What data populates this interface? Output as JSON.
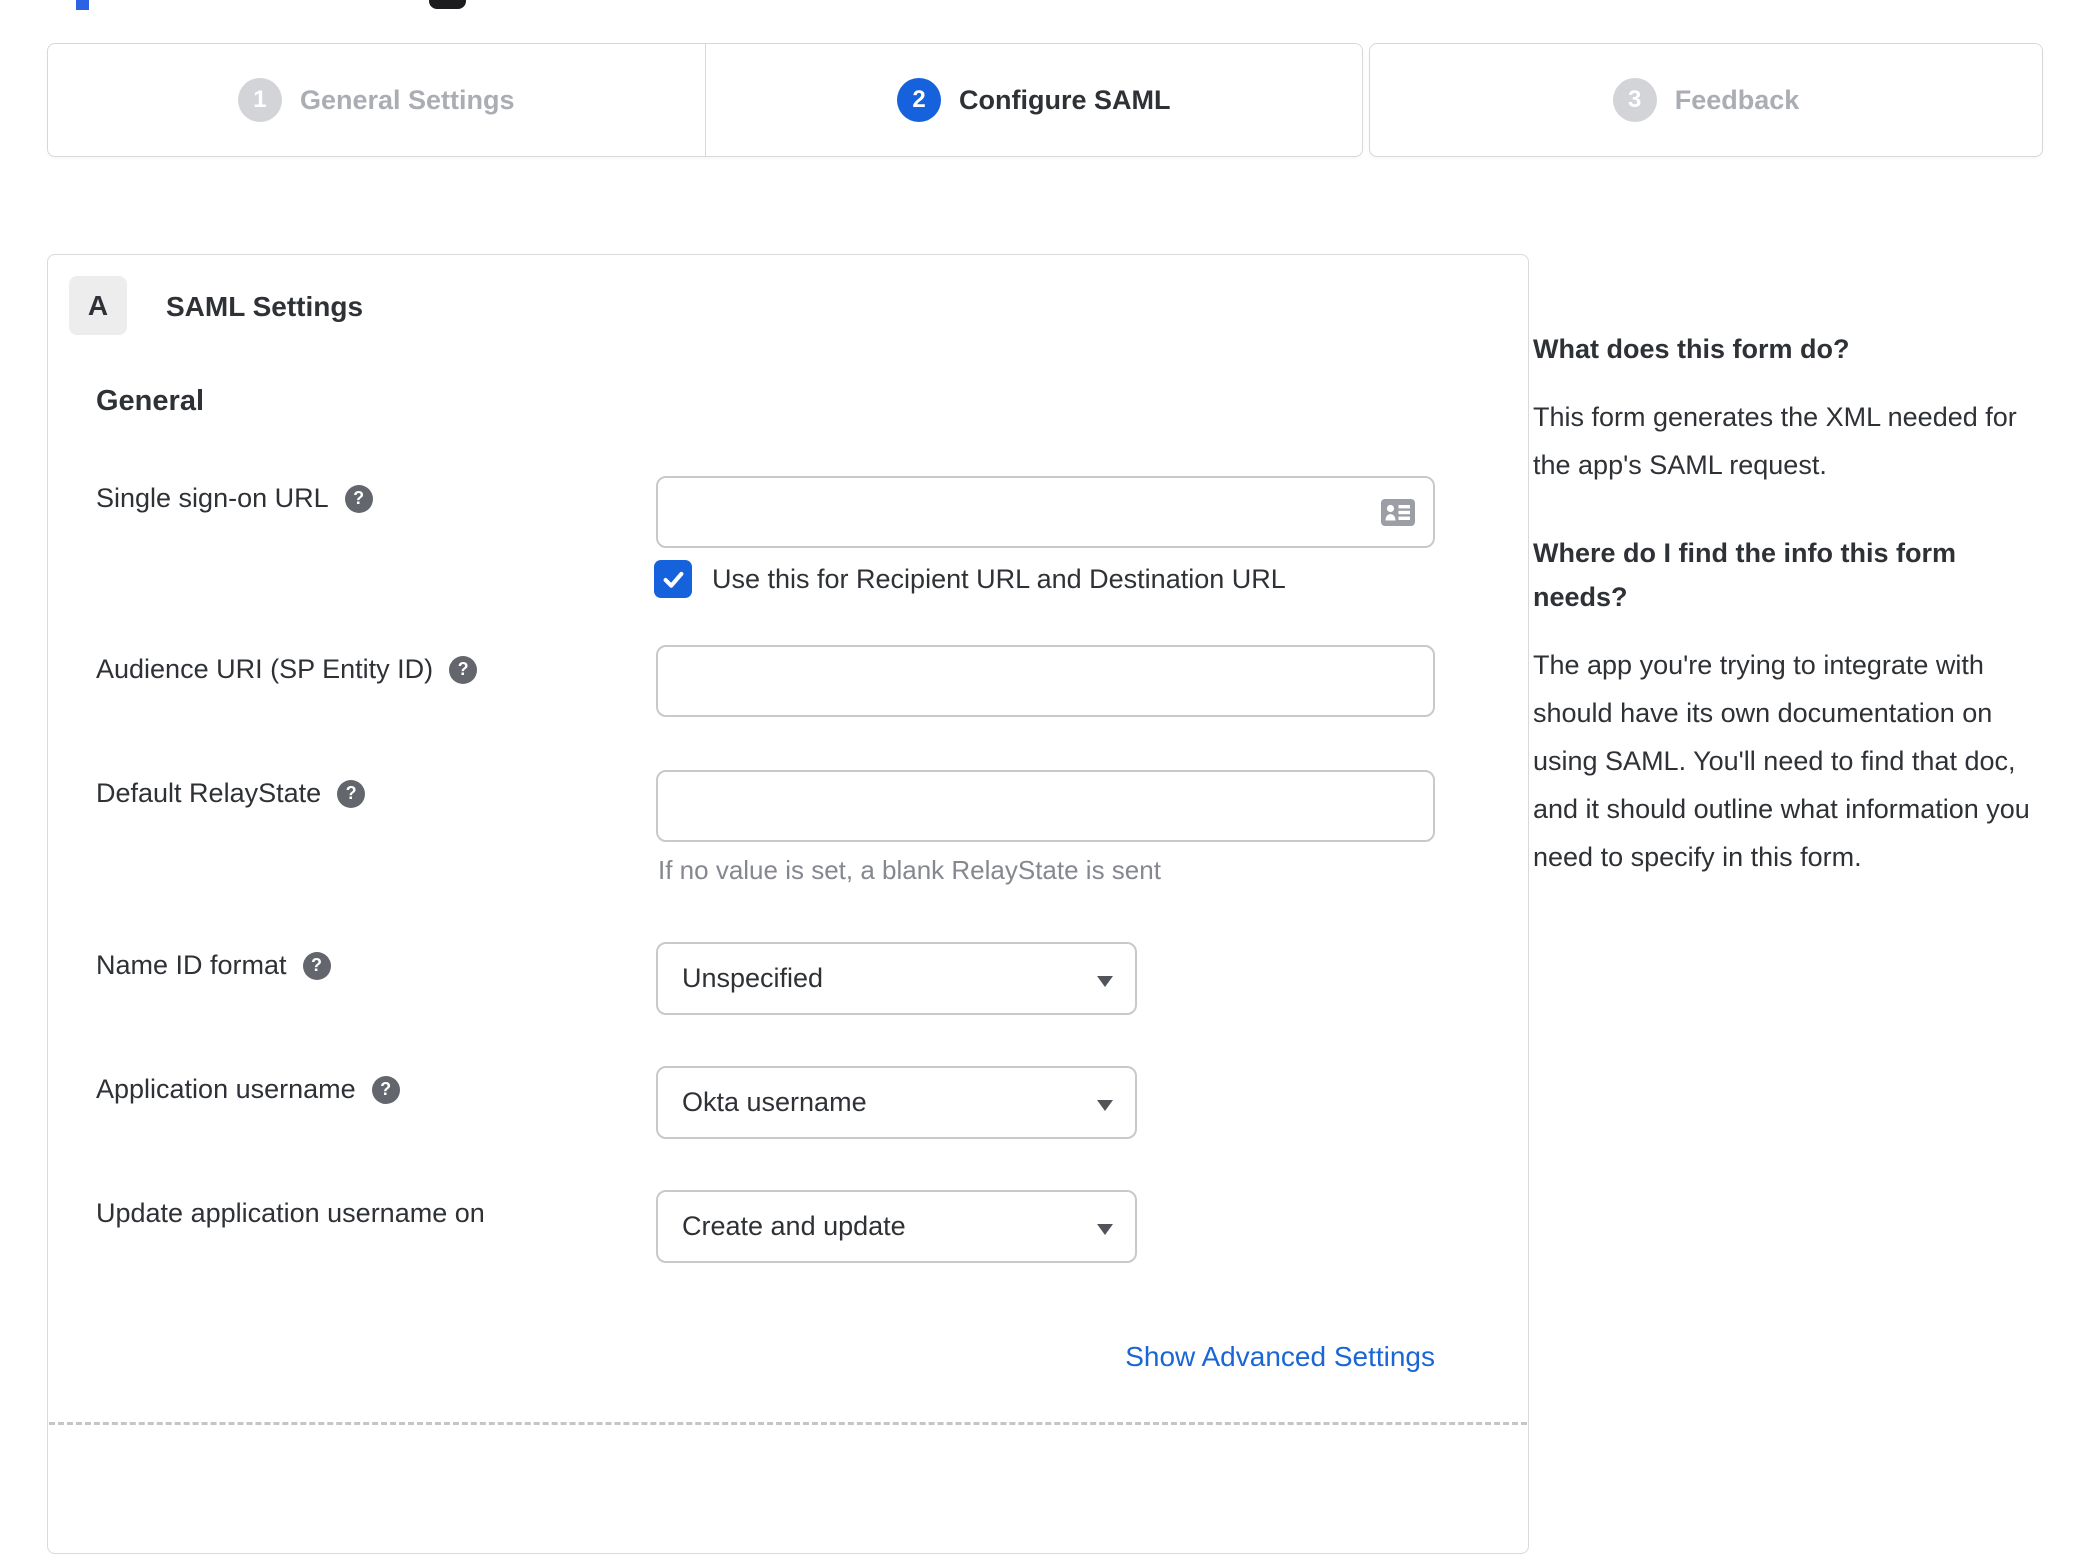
{
  "colors": {
    "accent_blue": "#1662dd",
    "link_blue": "#1a66d6",
    "inactive_gray": "#d3d4d7",
    "border_gray": "#c9c9cb"
  },
  "glyphs": {
    "help": "?"
  },
  "stepper": {
    "steps": [
      {
        "number": "1",
        "label": "General Settings",
        "state": "inactive"
      },
      {
        "number": "2",
        "label": "Configure SAML",
        "state": "active"
      },
      {
        "number": "3",
        "label": "Feedback",
        "state": "inactive"
      }
    ]
  },
  "panel": {
    "section_badge": "A",
    "section_title": "SAML Settings",
    "group_heading": "General",
    "form": {
      "sso": {
        "label": "Single sign-on URL",
        "value": "",
        "checkbox_label": "Use this for Recipient URL and Destination URL",
        "checked": true,
        "checked_aria": "true"
      },
      "audience": {
        "label": "Audience URI (SP Entity ID)",
        "value": ""
      },
      "relay": {
        "label": "Default RelayState",
        "value": "",
        "helper": "If no value is set, a blank RelayState is sent"
      },
      "name_id": {
        "label": "Name ID format",
        "value": "Unspecified"
      },
      "app_username": {
        "label": "Application username",
        "value": "Okta username"
      },
      "update_username": {
        "label": "Update application username on",
        "value": "Create and update"
      }
    },
    "advanced_link": "Show Advanced Settings"
  },
  "sidebar": {
    "heading1": "What does this form do?",
    "para1": "This form generates the XML needed for the app's SAML request.",
    "heading2": "Where do I find the info this form needs?",
    "para2": "The app you're trying to integrate with should have its own documentation on using SAML. You'll need to find that doc, and it should outline what information you need to specify in this form."
  }
}
